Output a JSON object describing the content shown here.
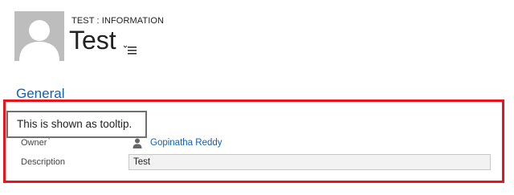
{
  "header": {
    "entity_label": "TEST : INFORMATION",
    "record_title": "Test",
    "avatar_icon": "user-silhouette-icon",
    "menu_icon": "list-menu-icon"
  },
  "section": {
    "title": "General"
  },
  "tooltip": {
    "text": "This is shown as tooltip."
  },
  "fields": {
    "owner": {
      "label": "Owner",
      "required_marker": "*",
      "value": "Gopinatha Reddy",
      "icon": "user-icon"
    },
    "description": {
      "label": "Description",
      "value": "Test"
    }
  },
  "colors": {
    "highlight_border": "#e8141c",
    "link": "#1160b7",
    "tooltip_border": "#707070"
  }
}
